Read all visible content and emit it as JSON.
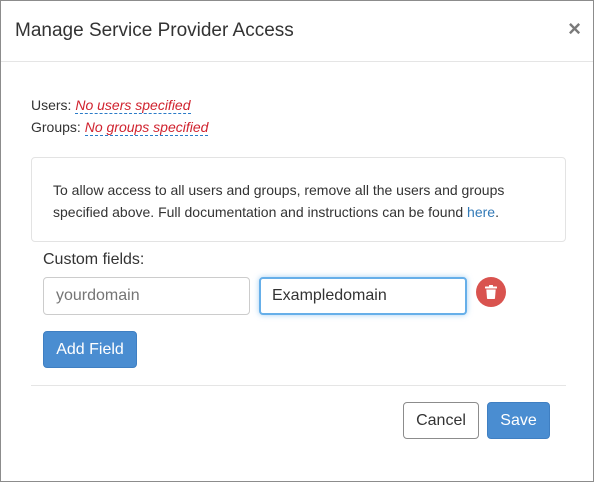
{
  "modal": {
    "title": "Manage Service Provider Access",
    "close_label": "×"
  },
  "access": {
    "users_label": "Users:",
    "users_value": "No users specified",
    "groups_label": "Groups:",
    "groups_value": "No groups specified"
  },
  "info": {
    "text": "To allow access to all users and groups, remove all the users and groups specified above. Full documentation and instructions can be found ",
    "link_label": "here",
    "text_end": "."
  },
  "custom_fields": {
    "label": "Custom fields:",
    "key_placeholder": "yourdomain",
    "value": "Exampledomain",
    "delete_icon": "trash-icon",
    "add_label": "Add Field"
  },
  "footer": {
    "cancel_label": "Cancel",
    "save_label": "Save"
  },
  "colors": {
    "primary": "#4a8dd1",
    "danger": "#d9534f",
    "empty_value": "#d0232f",
    "link": "#337ab7",
    "focus_border": "#66afe9"
  }
}
